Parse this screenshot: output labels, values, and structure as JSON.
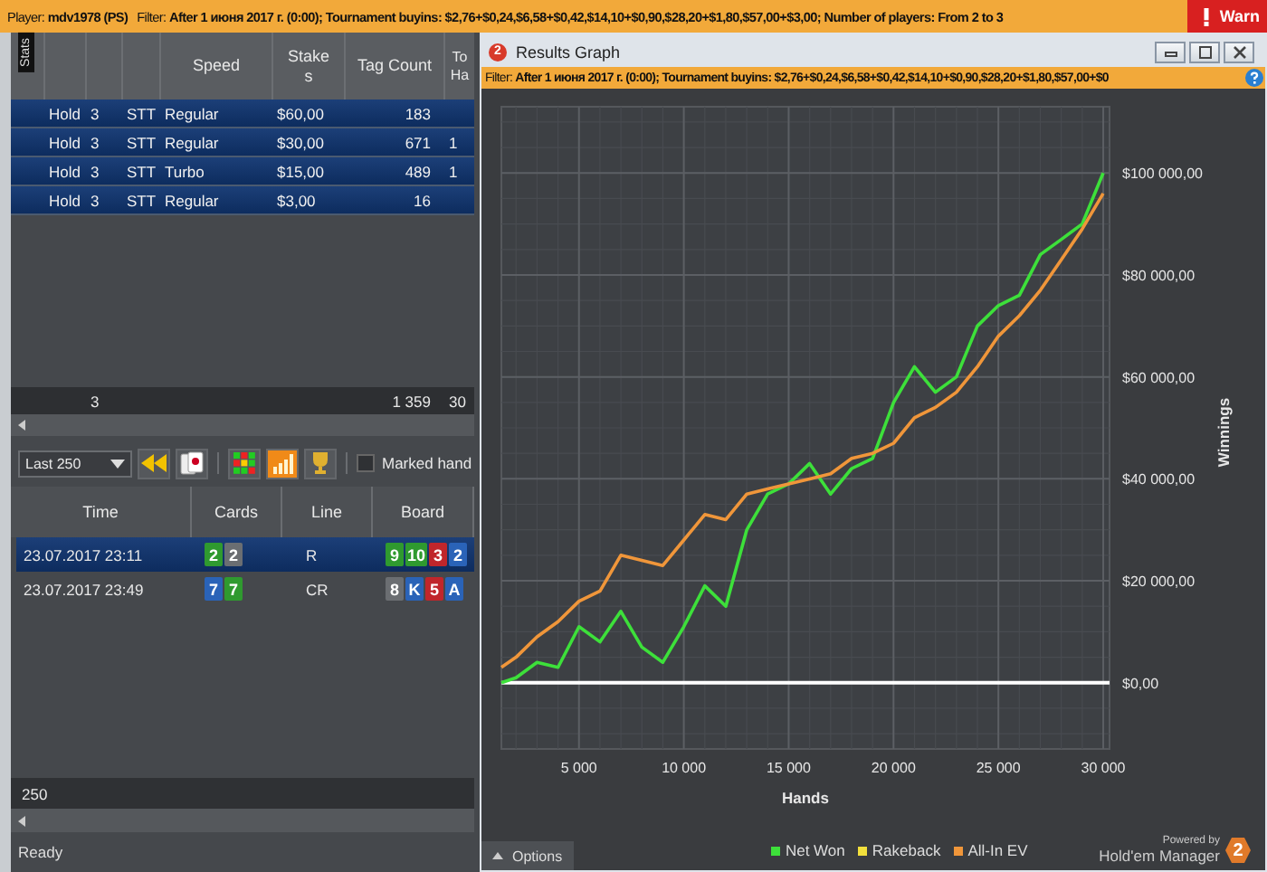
{
  "top_bar": {
    "player": "Player: **mdv1978 (PS)**",
    "filter": "Filter: **After 1 июня 2017 г. (0:00); Tournament buyins: $2,76+$0,24,$6,58+$0,42,$14,10+$0,90,$28,20+$1,80,$57,00+$3,00; Number of players: From 2 to 3**",
    "warning": "Warn"
  },
  "stats": {
    "tab": "Stats",
    "columns": [
      "",
      "",
      "",
      "Speed",
      "Stakes",
      "Tag Count",
      "To Ha"
    ],
    "rows": [
      {
        "cells": [
          "Hold",
          "3",
          "STT",
          "Regular",
          "$60,00",
          "183",
          ""
        ]
      },
      {
        "cells": [
          "Hold",
          "3",
          "STT",
          "Regular",
          "$30,00",
          "671",
          "1"
        ]
      },
      {
        "cells": [
          "Hold",
          "3",
          "STT",
          "Turbo",
          "$15,00",
          "489",
          "1"
        ]
      },
      {
        "cells": [
          "Hold",
          "3",
          "STT",
          "Regular",
          "$3,00",
          "16",
          ""
        ]
      }
    ],
    "totals": {
      "count": "3",
      "tag_count": "1 359",
      "column_7": "30"
    }
  },
  "toolbar": {
    "range": "Last 250",
    "buttons": [
      {
        "kind": "rewind",
        "selected": false
      },
      {
        "kind": "cards",
        "selected": false
      },
      {
        "kind": "grid",
        "selected": false
      },
      {
        "kind": "chart",
        "selected": true
      },
      {
        "kind": "trophy",
        "selected": false
      }
    ],
    "marked": {
      "label": "Marked hand",
      "checked": false
    }
  },
  "hands": {
    "columns": [
      "Time",
      "Cards",
      "Line",
      "Board"
    ],
    "rows": [
      {
        "time": "23.07.2017 23:11",
        "selected": true,
        "cards": [
          {
            "rank": "2",
            "color": "#2f9a2f"
          },
          {
            "rank": "2",
            "color": "#6b6e72"
          }
        ],
        "line": "R",
        "board": [
          {
            "rank": "9",
            "color": "#2f9a2f"
          },
          {
            "rank": "10",
            "color": "#2f9a2f"
          },
          {
            "rank": "3",
            "color": "#c0262b"
          },
          {
            "rank": "2",
            "color": "#2a63b8"
          }
        ]
      },
      {
        "time": "23.07.2017 23:49",
        "selected": false,
        "cards": [
          {
            "rank": "7",
            "color": "#2a63b8"
          },
          {
            "rank": "7",
            "color": "#2f9a2f"
          }
        ],
        "line": "CR",
        "board": [
          {
            "rank": "8",
            "color": "#6b6e72"
          },
          {
            "rank": "K",
            "color": "#2a63b8"
          },
          {
            "rank": "5",
            "color": "#c0262b"
          },
          {
            "rank": "A",
            "color": "#2a63b8"
          }
        ]
      }
    ],
    "count": "250"
  },
  "status_bar": "Ready",
  "results": {
    "window_title": "Results Graph",
    "logo": "2",
    "filter": "Filter: **After 1 июня 2017 г. (0:00); Tournament buyins: $2,76+$0,24,$6,58+$0,42,$14,10+$0,90,$28,20+$1,80,$57,00+$0**",
    "chart_data": {
      "type": "line",
      "xlabel": "Hands",
      "ylabel": "Winnings",
      "x": [
        1300,
        2000,
        3000,
        4000,
        5000,
        6000,
        7000,
        8000,
        9000,
        10000,
        11000,
        12000,
        13000,
        14000,
        15000,
        16000,
        17000,
        18000,
        19000,
        20000,
        21000,
        22000,
        23000,
        24000,
        25000,
        26000,
        27000,
        28000,
        29000,
        30000
      ],
      "series": [
        {
          "name": "Net Won",
          "color": "#3de03a",
          "values": [
            0,
            1000,
            4000,
            3000,
            11000,
            8000,
            14000,
            7000,
            4000,
            11000,
            19000,
            15000,
            30000,
            37000,
            39000,
            43000,
            37000,
            42000,
            44000,
            55000,
            62000,
            57000,
            60000,
            70000,
            74000,
            76000,
            84000,
            87000,
            90000,
            100000
          ]
        },
        {
          "name": "Rakeback",
          "color": "#f2e03c",
          "values": [
            null,
            null,
            null,
            null,
            null,
            null,
            null,
            null,
            null,
            null,
            null,
            null,
            null,
            null,
            null,
            null,
            null,
            null,
            null,
            null,
            null,
            null,
            null,
            null,
            null,
            null,
            null,
            null,
            null,
            null
          ]
        },
        {
          "name": "All-In EV",
          "color": "#f0963a",
          "values": [
            3000,
            5000,
            9000,
            12000,
            16000,
            18000,
            25000,
            24000,
            23000,
            28000,
            33000,
            32000,
            37000,
            38000,
            39000,
            40000,
            41000,
            44000,
            45000,
            47000,
            52000,
            54000,
            57000,
            62000,
            68000,
            72000,
            77000,
            83000,
            89000,
            96000
          ]
        }
      ],
      "grid": true,
      "xlim": [
        1300,
        30300
      ],
      "ylim": [
        -13000,
        113000
      ],
      "xticks": [
        {
          "value": 5000,
          "label": "5 000"
        },
        {
          "value": 10000,
          "label": "10 000"
        },
        {
          "value": 15000,
          "label": "15 000"
        },
        {
          "value": 20000,
          "label": "20 000"
        },
        {
          "value": 25000,
          "label": "25 000"
        },
        {
          "value": 30000,
          "label": "30 000"
        }
      ],
      "yticks": [
        {
          "value": 0,
          "label": "$0,00"
        },
        {
          "value": 20000,
          "label": "$20 000,00"
        },
        {
          "value": 40000,
          "label": "$40 000,00"
        },
        {
          "value": 60000,
          "label": "$60 000,00"
        },
        {
          "value": 80000,
          "label": "$80 000,00"
        },
        {
          "value": 100000,
          "label": "$100 000,00"
        }
      ]
    },
    "options": "Options",
    "powered_by": "Powered by",
    "brand": "Hold'em Manager",
    "brand_mark": "2"
  }
}
